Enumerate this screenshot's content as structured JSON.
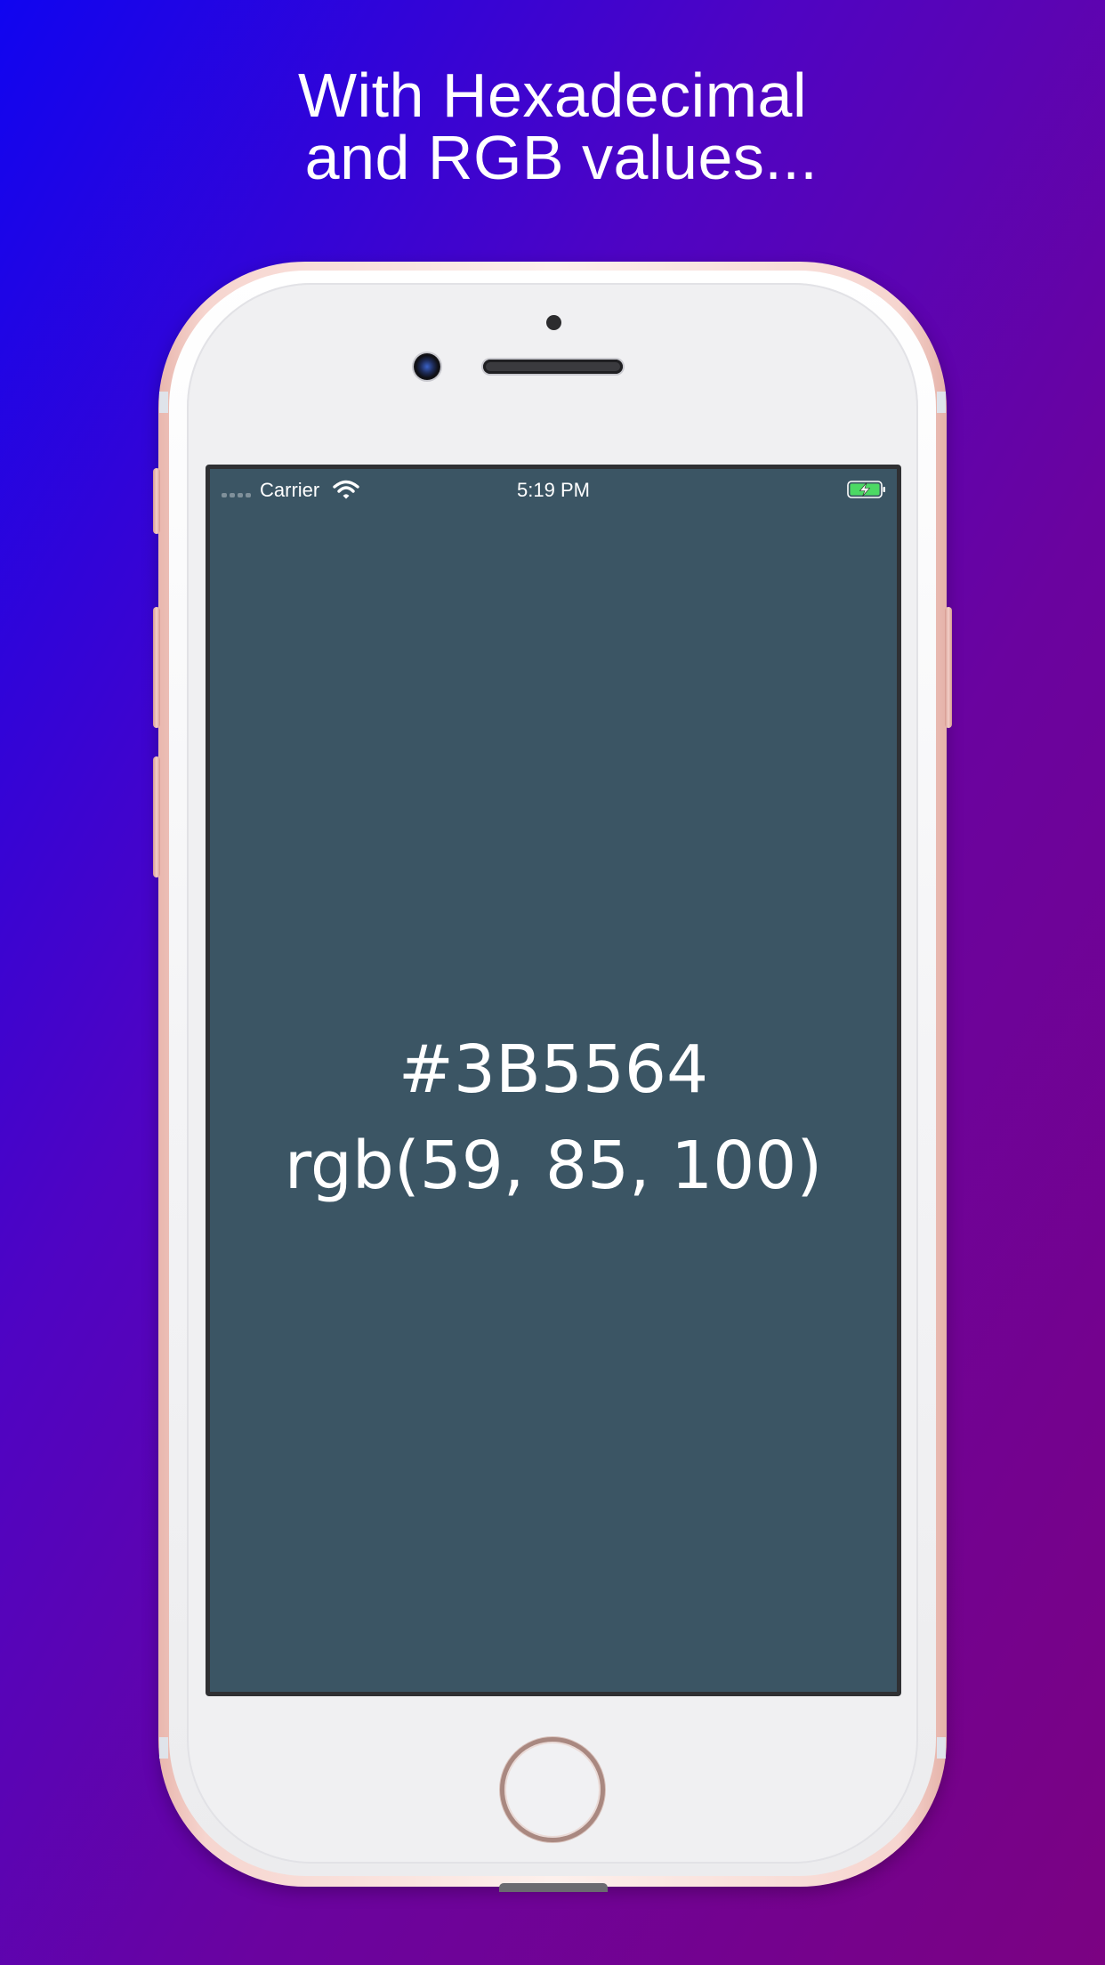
{
  "headline": {
    "line1": "With Hexadecimal",
    "line2": " and RGB values..."
  },
  "status_bar": {
    "carrier": "Carrier",
    "time": "5:19 PM",
    "icons": [
      "signal-dots-icon",
      "wifi-icon",
      "battery-charging-icon"
    ]
  },
  "color_display": {
    "hex": "#3B5564",
    "rgb": "rgb(59, 85, 100)",
    "background_color": "#3B5564"
  },
  "theme": {
    "gradient_start": "#1005F0",
    "gradient_end": "#7B0282",
    "device_color": "rose-gold"
  }
}
